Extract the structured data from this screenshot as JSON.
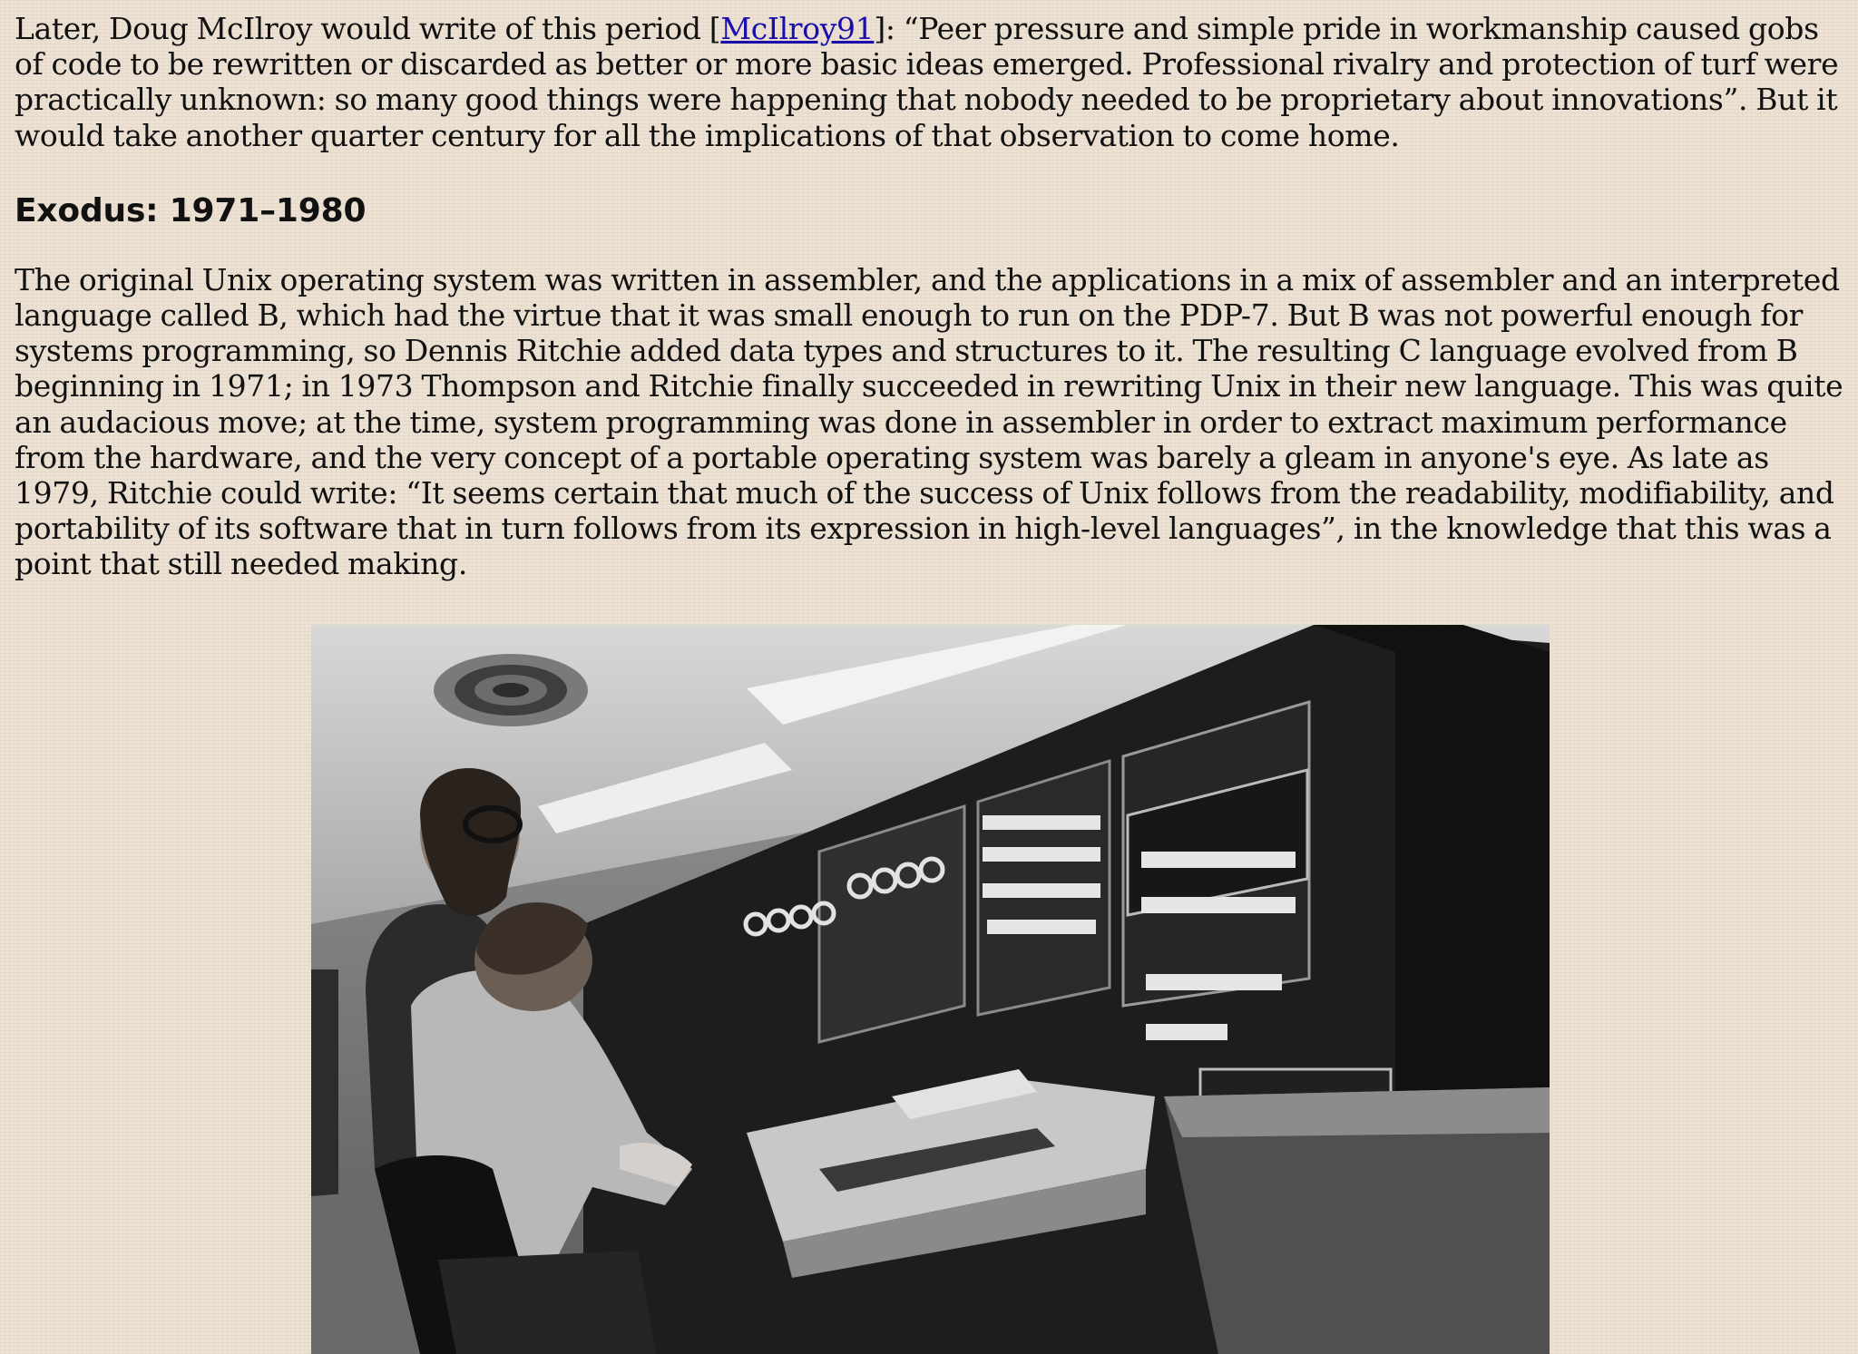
{
  "paragraph1": {
    "before_link": "Later, Doug McIlroy would write of this period [",
    "link_text": "McIlroy91",
    "after_link": "]: “Peer pressure and simple pride in workmanship caused gobs of code to be rewritten or discarded as better or more basic ideas emerged. Professional rivalry and protection of turf were practically unknown: so many good things were happening that nobody needed to be proprietary about innovations”. But it would take another quarter century for all the implications of that observation to come home."
  },
  "section": {
    "heading": "Exodus: 1971–1980",
    "paragraph": "The original Unix operating system was written in assembler, and the applications in a mix of assembler and an interpreted language called B, which had the virtue that it was small enough to run on the PDP-7. But B was not powerful enough for systems programming, so Dennis Ritchie added data types and structures to it. The resulting C language evolved from B beginning in 1971; in 1973 Thompson and Ritchie finally succeeded in rewriting Unix in their new language. This was quite an audacious move; at the time, system programming was done in assembler in order to extract maximum performance from the hardware, and the very concept of a portable operating system was barely a gleam in anyone's eye. As late as 1979, Ritchie could write: “It seems certain that much of the success of Unix follows from the readability, modifiability, and portability of its software that in turn follows from its expression in high-level languages”, in the knowledge that this was a point that still needed making."
  },
  "colors": {
    "background": "#ece1d3",
    "link": "#1a0dab",
    "text": "#111111"
  }
}
